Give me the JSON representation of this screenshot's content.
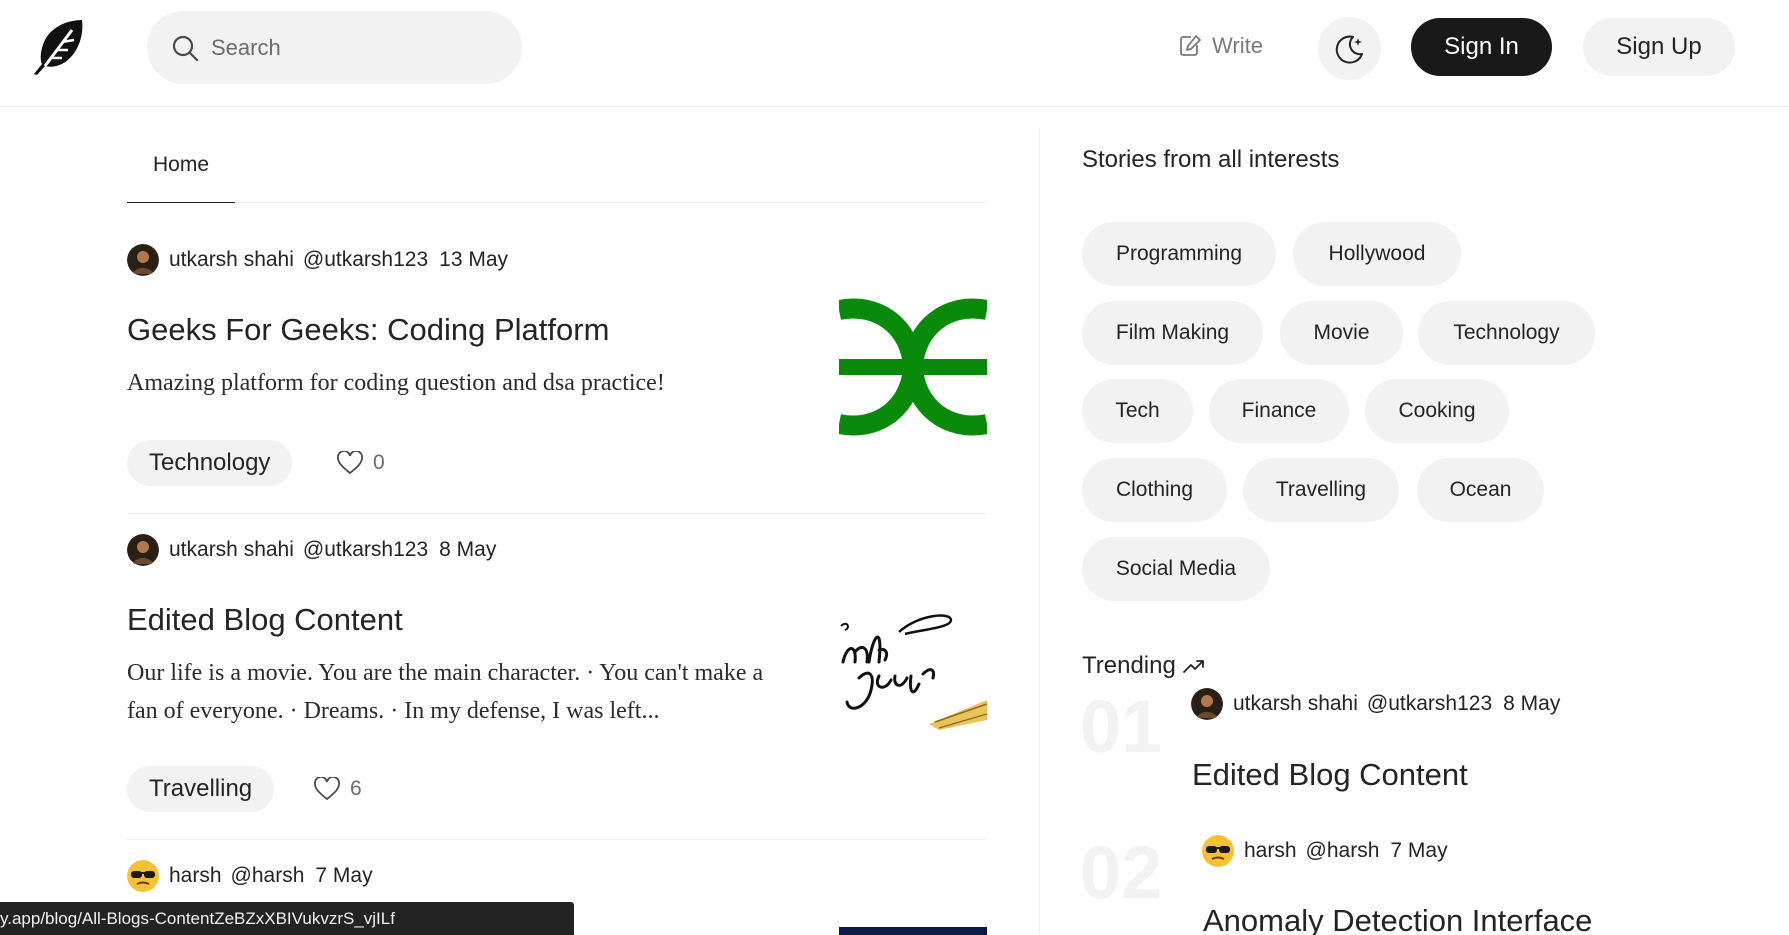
{
  "header": {
    "search_placeholder": "Search",
    "write_label": "Write",
    "signin_label": "Sign In",
    "signup_label": "Sign Up"
  },
  "feed": {
    "tabs": [
      {
        "label": "Home"
      }
    ],
    "posts": [
      {
        "author": "utkarsh shahi",
        "handle": "@utkarsh123",
        "date": "13 May",
        "title": "Geeks For Geeks: Coding Platform",
        "excerpt": "Amazing platform for coding question and dsa practice!",
        "tag": "Technology",
        "likes": "0"
      },
      {
        "author": "utkarsh shahi",
        "handle": "@utkarsh123",
        "date": "8 May",
        "title": "Edited Blog Content",
        "excerpt": "Our life is a movie. You are the main character. · You can't make a fan of everyone. · Dreams. · In my defense, I was left...",
        "tag": "Travelling",
        "likes": "6"
      },
      {
        "author": "harsh",
        "handle": "@harsh",
        "date": "7 May"
      }
    ]
  },
  "status_url": "y.app/blog/All-Blogs-ContentZeBZxXBIVukvzrS_vjILf",
  "sidebar": {
    "heading": "Stories from all interests",
    "topics": [
      "Programming",
      "Hollywood",
      "Film Making",
      "Movie",
      "Technology",
      "Tech",
      "Finance",
      "Cooking",
      "Clothing",
      "Travelling",
      "Ocean",
      "Social Media"
    ],
    "trending_label": "Trending",
    "trending": [
      {
        "rank": "01",
        "author": "utkarsh shahi",
        "handle": "@utkarsh123",
        "date": "8 May",
        "title": "Edited Blog Content"
      },
      {
        "rank": "02",
        "author": "harsh",
        "handle": "@harsh",
        "date": "7 May",
        "title": "Anomaly Detection Interface"
      }
    ]
  },
  "icons": {
    "logo": "feather-logo-icon",
    "search": "search-icon",
    "write": "write-icon",
    "theme": "moon-stars-icon",
    "like": "heart-icon",
    "trending": "trending-arrow-icon"
  }
}
